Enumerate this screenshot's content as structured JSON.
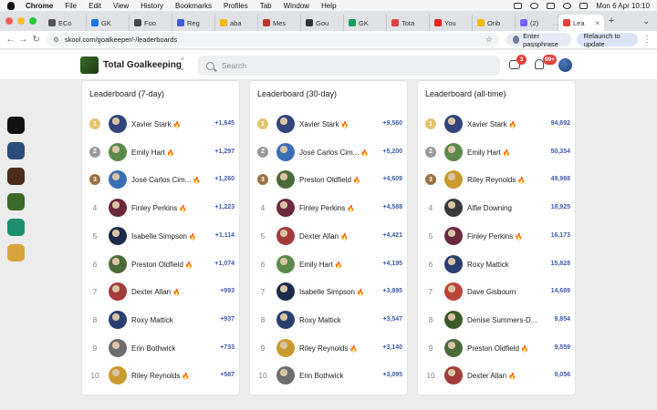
{
  "menubar": {
    "app_name": "Chrome",
    "items": [
      "File",
      "Edit",
      "View",
      "History",
      "Bookmarks",
      "Profiles",
      "Tab",
      "Window",
      "Help"
    ],
    "clock": "Mon 6 Apr  10:10"
  },
  "tabs": [
    {
      "label": "ECo",
      "color": "#555"
    },
    {
      "label": "GK",
      "color": "#1a73e8"
    },
    {
      "label": "Foo",
      "color": "#444"
    },
    {
      "label": "Reg",
      "color": "#3b5bdb"
    },
    {
      "label": "aba",
      "color": "#f5b800"
    },
    {
      "label": "Mes",
      "color": "#c0392b"
    },
    {
      "label": "Gou",
      "color": "#333"
    },
    {
      "label": "GK",
      "color": "#0f9d58"
    },
    {
      "label": "Tota",
      "color": "#e0413c"
    },
    {
      "label": "You",
      "color": "#e62117"
    },
    {
      "label": "Onb",
      "color": "#f5b800"
    },
    {
      "label": "(2)",
      "color": "#7b61ff"
    },
    {
      "label": "Lea",
      "color": "#e0413c",
      "active": true
    }
  ],
  "toolbar": {
    "url": "skool.com/goalkeeper/-/leaderboards",
    "passphrase_label": "Enter passphrase",
    "relaunch_label": "Relaunch to update"
  },
  "header": {
    "group_name": "Total Goalkeeping",
    "search_placeholder": "Search",
    "chat_badge": "3",
    "notif_badge": "99+"
  },
  "dock_apps": [
    {
      "name": "arc-app",
      "color": "#111"
    },
    {
      "name": "app-2",
      "color": "#2a4d7a"
    },
    {
      "name": "app-3",
      "color": "#4a2e1a"
    },
    {
      "name": "app-4",
      "color": "#3b6b2a"
    },
    {
      "name": "app-5",
      "color": "#1d8f6e"
    },
    {
      "name": "app-6",
      "color": "#d9a33b"
    }
  ],
  "boards": [
    {
      "title": "Leaderboard (7-day)",
      "rows": [
        {
          "rank": "1",
          "name": "Xavier Stark",
          "flame": true,
          "points": "+1,645",
          "avatar": "#33457a"
        },
        {
          "rank": "2",
          "name": "Emily Hart",
          "flame": true,
          "points": "+1,297",
          "avatar": "#5d8a4c"
        },
        {
          "rank": "3",
          "name": "José Carlos Cim...",
          "flame": true,
          "points": "+1,260",
          "avatar": "#3b6fb5"
        },
        {
          "rank": "4",
          "name": "Finley Perkins",
          "flame": true,
          "points": "+1,223",
          "avatar": "#6b2a3c"
        },
        {
          "rank": "5",
          "name": "Isabelle Simpson",
          "flame": true,
          "points": "+1,114",
          "avatar": "#1d2b4a"
        },
        {
          "rank": "6",
          "name": "Preston Oldfield",
          "flame": true,
          "points": "+1,074",
          "avatar": "#4c6b3a"
        },
        {
          "rank": "7",
          "name": "Dexter Allan",
          "flame": true,
          "points": "+993",
          "avatar": "#a33b3b"
        },
        {
          "rank": "8",
          "name": "Roxy Mattick",
          "flame": false,
          "points": "+937",
          "avatar": "#2a3f6e"
        },
        {
          "rank": "9",
          "name": "Erin Bothwick",
          "flame": false,
          "points": "+733",
          "avatar": "#6d6d6d"
        },
        {
          "rank": "10",
          "name": "Riley Reynolds",
          "flame": true,
          "points": "+587",
          "avatar": "#c99a2e"
        }
      ]
    },
    {
      "title": "Leaderboard (30-day)",
      "rows": [
        {
          "rank": "1",
          "name": "Xavier Stark",
          "flame": true,
          "points": "+9,560",
          "avatar": "#33457a"
        },
        {
          "rank": "2",
          "name": "José Carlos Cim...",
          "flame": true,
          "points": "+5,200",
          "avatar": "#3b6fb5"
        },
        {
          "rank": "3",
          "name": "Preston Oldfield",
          "flame": true,
          "points": "+4,609",
          "avatar": "#4c6b3a"
        },
        {
          "rank": "4",
          "name": "Finley Perkins",
          "flame": true,
          "points": "+4,588",
          "avatar": "#6b2a3c"
        },
        {
          "rank": "5",
          "name": "Dexter Allan",
          "flame": true,
          "points": "+4,421",
          "avatar": "#a33b3b"
        },
        {
          "rank": "6",
          "name": "Emily Hart",
          "flame": true,
          "points": "+4,195",
          "avatar": "#5d8a4c"
        },
        {
          "rank": "7",
          "name": "Isabelle Simpson",
          "flame": true,
          "points": "+3,895",
          "avatar": "#1d2b4a"
        },
        {
          "rank": "8",
          "name": "Roxy Mattick",
          "flame": false,
          "points": "+3,547",
          "avatar": "#2a3f6e"
        },
        {
          "rank": "9",
          "name": "Riley Reynolds",
          "flame": true,
          "points": "+3,140",
          "avatar": "#c99a2e"
        },
        {
          "rank": "10",
          "name": "Erin Bothwick",
          "flame": false,
          "points": "+3,095",
          "avatar": "#6d6d6d"
        }
      ]
    },
    {
      "title": "Leaderboard (all-time)",
      "rows": [
        {
          "rank": "1",
          "name": "Xavier Stark",
          "flame": true,
          "points": "94,692",
          "avatar": "#33457a"
        },
        {
          "rank": "2",
          "name": "Emily Hart",
          "flame": true,
          "points": "50,354",
          "avatar": "#5d8a4c"
        },
        {
          "rank": "3",
          "name": "Riley Reynolds",
          "flame": true,
          "points": "49,988",
          "avatar": "#c99a2e"
        },
        {
          "rank": "4",
          "name": "Alfie Downing",
          "flame": false,
          "points": "18,925",
          "avatar": "#3a3a3a"
        },
        {
          "rank": "5",
          "name": "Finley Perkins",
          "flame": true,
          "points": "16,173",
          "avatar": "#6b2a3c"
        },
        {
          "rank": "6",
          "name": "Roxy Mattick",
          "flame": false,
          "points": "15,828",
          "avatar": "#2a3f6e"
        },
        {
          "rank": "7",
          "name": "Dave Gisbourn",
          "flame": false,
          "points": "14,689",
          "avatar": "#b8453a"
        },
        {
          "rank": "8",
          "name": "Denise Summers-D...",
          "flame": false,
          "points": "9,854",
          "avatar": "#3c5a2a"
        },
        {
          "rank": "9",
          "name": "Preston Oldfield",
          "flame": true,
          "points": "9,559",
          "avatar": "#4c6b3a"
        },
        {
          "rank": "10",
          "name": "Dexter Allan",
          "flame": true,
          "points": "9,056",
          "avatar": "#a33b3b"
        }
      ]
    }
  ]
}
